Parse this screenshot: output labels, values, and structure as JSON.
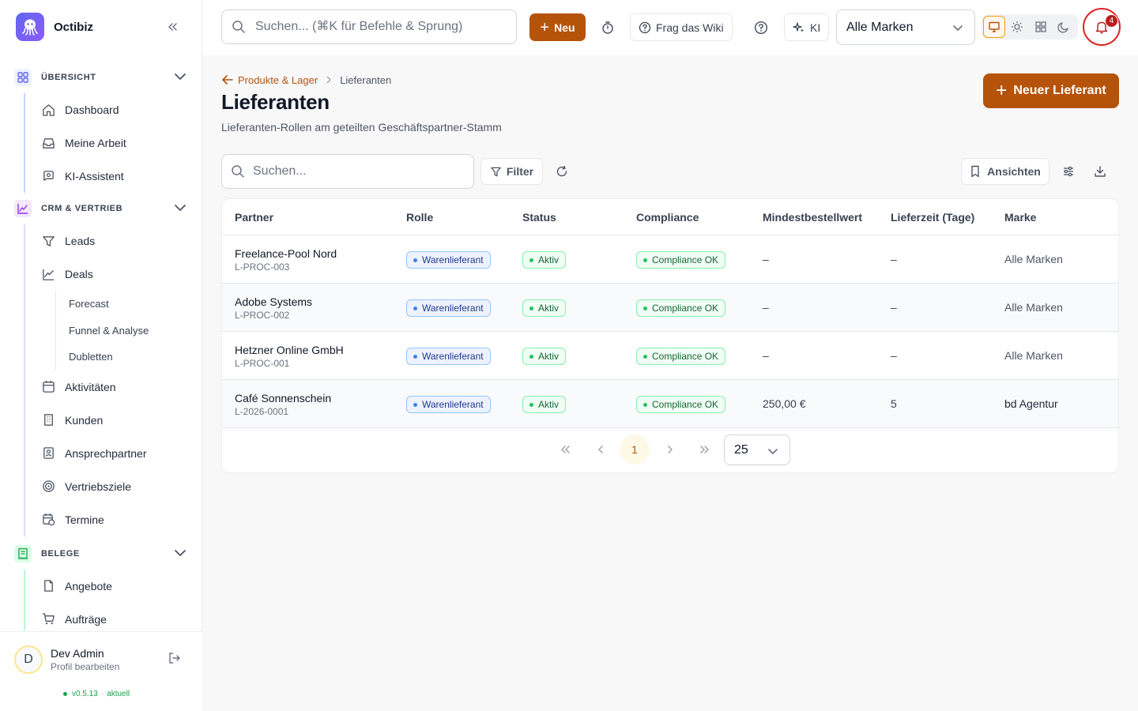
{
  "app": {
    "name": "Octibiz"
  },
  "colors": {
    "accent": "#b45309",
    "notification": "#b91c1c",
    "success": "#16a34a",
    "role": "#3b82f6"
  },
  "sidebar": {
    "sections": [
      {
        "label": "ÜBERSICHT",
        "icon": "grid-icon",
        "items": [
          "Dashboard",
          "Meine Arbeit",
          "KI-Assistent"
        ]
      },
      {
        "label": "CRM & VERTRIEB",
        "icon": "chart-line-icon",
        "items": [
          "Leads",
          "Deals",
          "Aktivitäten",
          "Kunden",
          "Ansprechpartner",
          "Vertriebsziele",
          "Termine"
        ],
        "deals_sub": [
          "Forecast",
          "Funnel & Analyse",
          "Dubletten"
        ]
      },
      {
        "label": "BELEGE",
        "icon": "receipt-icon",
        "items": [
          "Angebote",
          "Aufträge"
        ]
      }
    ],
    "profile": {
      "initial": "D",
      "name": "Dev Admin",
      "sub": "Profil bearbeiten"
    },
    "version": {
      "number": "v0.5.13",
      "state": "aktuell"
    }
  },
  "topbar": {
    "search_placeholder": "Suchen... (⌘K für Befehle & Sprung)",
    "new_label": "Neu",
    "wiki_label": "Frag das Wiki",
    "ai_label": "KI",
    "brand_selected": "Alle Marken",
    "notification_count": "4"
  },
  "page": {
    "breadcrumb_parent": "Produkte & Lager",
    "breadcrumb_current": "Lieferanten",
    "title": "Lieferanten",
    "subtitle": "Lieferanten-Rollen am geteilten Geschäftspartner-Stamm",
    "primary_button": "Neuer Lieferant",
    "search_placeholder": "Suchen...",
    "filter_label": "Filter",
    "views_label": "Ansichten"
  },
  "table": {
    "columns": [
      "Partner",
      "Rolle",
      "Status",
      "Compliance",
      "Mindestbestellwert",
      "Lieferzeit (Tage)",
      "Marke"
    ],
    "rows": [
      {
        "name": "Freelance-Pool Nord",
        "id": "L-PROC-003",
        "role": "Warenlieferant",
        "status": "Aktiv",
        "compliance": "Compliance OK",
        "min_order": "–",
        "lead_time": "–",
        "brand": "Alle Marken"
      },
      {
        "name": "Adobe Systems",
        "id": "L-PROC-002",
        "role": "Warenlieferant",
        "status": "Aktiv",
        "compliance": "Compliance OK",
        "min_order": "–",
        "lead_time": "–",
        "brand": "Alle Marken"
      },
      {
        "name": "Hetzner Online GmbH",
        "id": "L-PROC-001",
        "role": "Warenlieferant",
        "status": "Aktiv",
        "compliance": "Compliance OK",
        "min_order": "–",
        "lead_time": "–",
        "brand": "Alle Marken"
      },
      {
        "name": "Café Sonnenschein",
        "id": "L-2026-0001",
        "role": "Warenlieferant",
        "status": "Aktiv",
        "compliance": "Compliance OK",
        "min_order": "250,00 €",
        "lead_time": "5",
        "brand": "bd Agentur"
      }
    ]
  },
  "pagination": {
    "current_page": "1",
    "page_size": "25"
  }
}
